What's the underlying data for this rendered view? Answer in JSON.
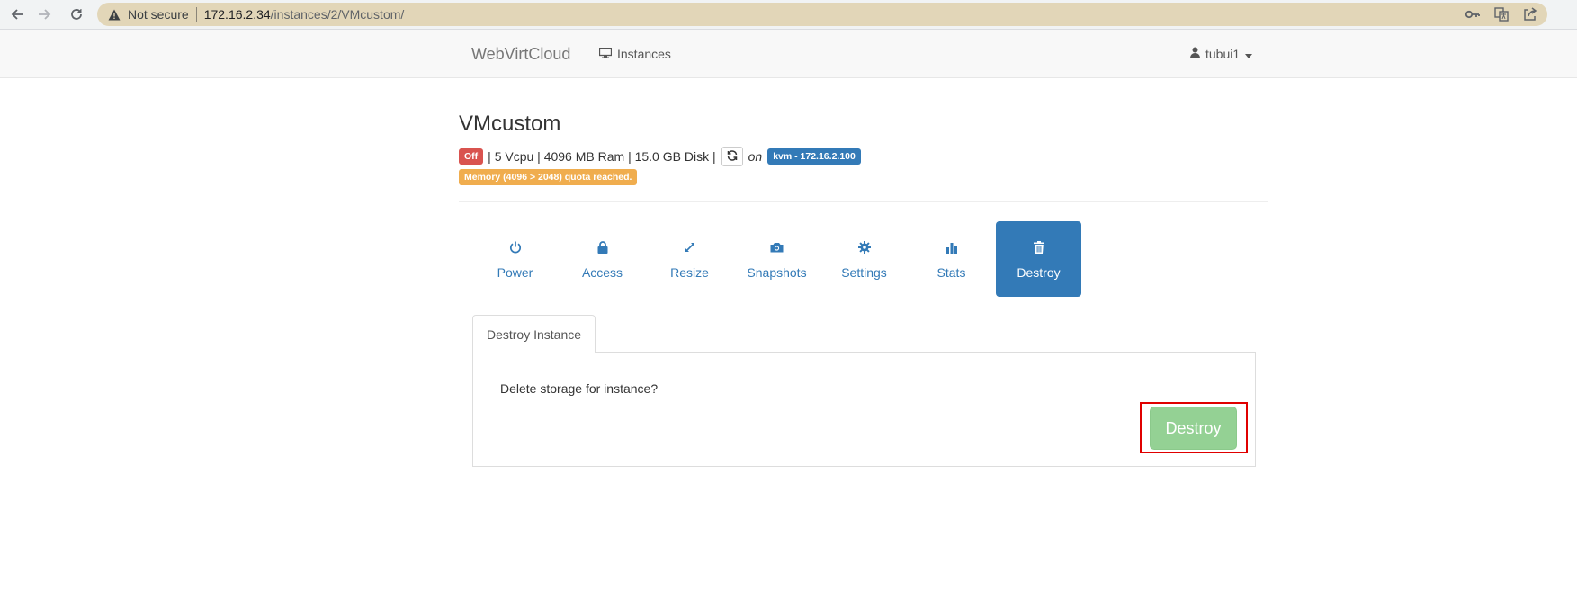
{
  "browser": {
    "security_text": "Not secure",
    "url_host": "172.16.2.34",
    "url_path": "/instances/2/VMcustom/"
  },
  "navbar": {
    "brand": "WebVirtCloud",
    "instances_label": "Instances",
    "user_label": "tubui1"
  },
  "instance": {
    "name": "VMcustom",
    "status": "Off",
    "specs": "| 5 Vcpu | 4096 MB Ram | 15.0 GB Disk |",
    "on_text": "on",
    "host": "kvm - 172.16.2.100",
    "quota_warning": "Memory (4096 > 2048) quota reached."
  },
  "tabs": [
    {
      "label": "Power",
      "icon": "power-icon"
    },
    {
      "label": "Access",
      "icon": "lock-icon"
    },
    {
      "label": "Resize",
      "icon": "resize-icon"
    },
    {
      "label": "Snapshots",
      "icon": "camera-icon"
    },
    {
      "label": "Settings",
      "icon": "gear-icon"
    },
    {
      "label": "Stats",
      "icon": "bar-chart-icon"
    },
    {
      "label": "Destroy",
      "icon": "trash-icon",
      "active": true
    }
  ],
  "destroy_panel": {
    "subtab_label": "Destroy Instance",
    "prompt": "Delete storage for instance?",
    "button_label": "Destroy"
  },
  "colors": {
    "primary": "#337ab7",
    "danger": "#d9534f",
    "warning": "#f0ad4e",
    "success_disabled": "#94d194",
    "highlight": "#e00000"
  }
}
